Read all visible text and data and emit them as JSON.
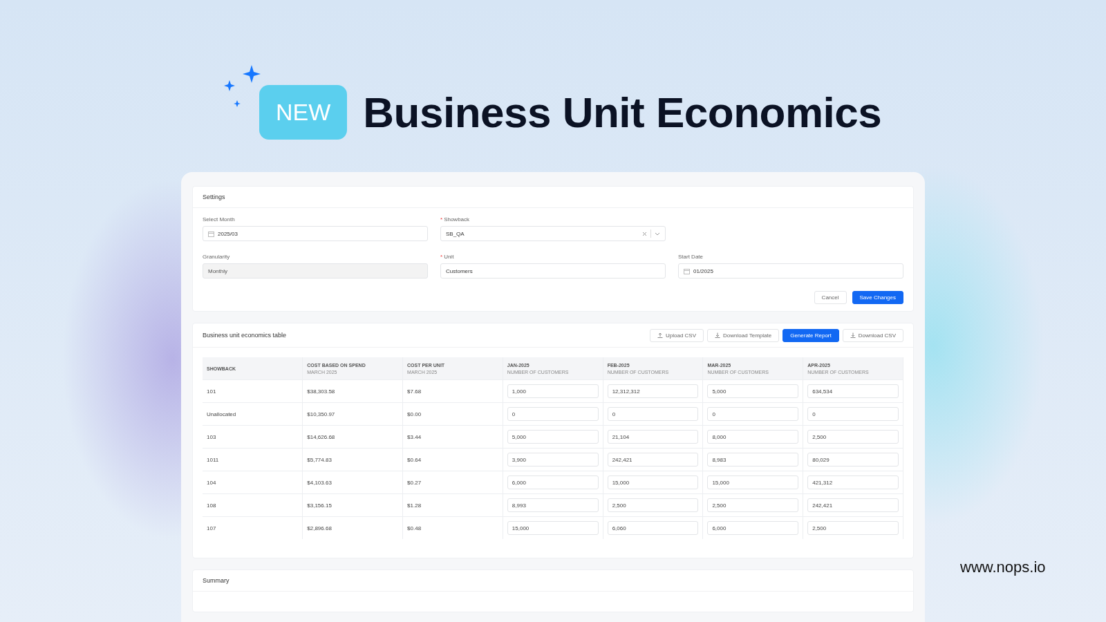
{
  "hero": {
    "badge": "NEW",
    "title": "Business Unit Economics"
  },
  "settings": {
    "title": "Settings",
    "field_rows": [
      [
        {
          "label": "Select Month",
          "kind": "date",
          "value": "2025/03",
          "disabled": false
        },
        {
          "required_mark": "*",
          "label": "Showback",
          "kind": "select",
          "value": "SB_QA",
          "disabled": false
        }
      ],
      [
        {
          "label": "Granularity",
          "kind": "text",
          "value": "Monthly",
          "disabled": true
        },
        {
          "required_mark": "*",
          "label": "Unit",
          "kind": "text",
          "value": "Customers",
          "disabled": false
        },
        {
          "label": "Start Date",
          "kind": "date",
          "value": "01/2025",
          "disabled": false
        }
      ]
    ],
    "buttons": [
      {
        "label": "Cancel",
        "kind": "secondary"
      },
      {
        "label": "Save Changes",
        "kind": "primary"
      }
    ]
  },
  "table": {
    "title": "Business unit economics table",
    "buttons": [
      {
        "label": "Upload CSV",
        "kind": "upload"
      },
      {
        "label": "Download Template",
        "kind": "download"
      },
      {
        "label": "Generate Report",
        "kind": "primary"
      },
      {
        "label": "Download CSV",
        "kind": "download"
      }
    ],
    "columns": [
      {
        "title": "SHOWBACK"
      },
      {
        "title": "COST BASED ON SPEND",
        "subtitle": "MARCH 2025"
      },
      {
        "title": "COST PER UNIT",
        "subtitle": "MARCH 2025"
      },
      {
        "title": "JAN-2025",
        "subtitle": "NUMBER OF CUSTOMERS"
      },
      {
        "title": "FEB-2025",
        "subtitle": "NUMBER OF CUSTOMERS"
      },
      {
        "title": "MAR-2025",
        "subtitle": "NUMBER OF CUSTOMERS"
      },
      {
        "title": "APR-2025",
        "subtitle": "NUMBER OF CUSTOMERS"
      }
    ],
    "rows": [
      {
        "showback": "101",
        "cost": "$38,303.58",
        "unit_cost": "$7.68",
        "counts": [
          "1,000",
          "12,312,312",
          "5,000",
          "634,534"
        ]
      },
      {
        "showback": "Unallocated",
        "cost": "$10,350.97",
        "unit_cost": "$0.00",
        "counts": [
          "0",
          "0",
          "0",
          "0"
        ]
      },
      {
        "showback": "103",
        "cost": "$14,626.68",
        "unit_cost": "$3.44",
        "counts": [
          "5,000",
          "21,104",
          "8,000",
          "2,500"
        ]
      },
      {
        "showback": "1011",
        "cost": "$5,774.83",
        "unit_cost": "$0.64",
        "counts": [
          "3,900",
          "242,421",
          "8,983",
          "80,029"
        ]
      },
      {
        "showback": "104",
        "cost": "$4,103.63",
        "unit_cost": "$0.27",
        "counts": [
          "6,000",
          "15,000",
          "15,000",
          "421,312"
        ]
      },
      {
        "showback": "108",
        "cost": "$3,156.15",
        "unit_cost": "$1.28",
        "counts": [
          "8,993",
          "2,500",
          "2,500",
          "242,421"
        ]
      },
      {
        "showback": "107",
        "cost": "$2,896.68",
        "unit_cost": "$0.48",
        "counts": [
          "15,000",
          "6,060",
          "6,000",
          "2,500"
        ]
      }
    ]
  },
  "summary": {
    "title": "Summary"
  },
  "footer": {
    "url": "www.nops.io"
  }
}
